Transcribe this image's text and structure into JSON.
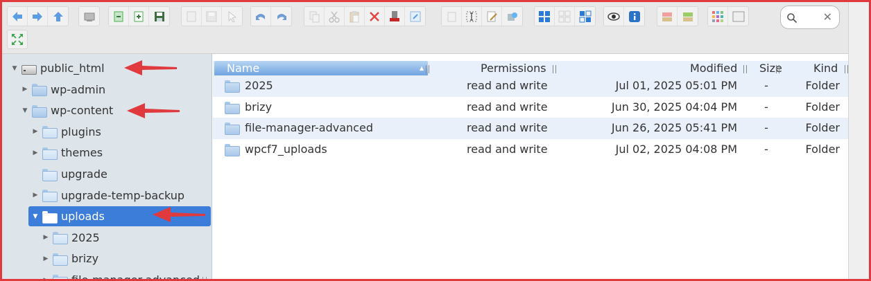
{
  "toolbar": {
    "groups": [
      [
        "back-icon",
        "forward-icon",
        "up-icon"
      ],
      [
        "home-icon"
      ],
      [
        "reload-icon",
        "new-file-icon",
        "save-icon"
      ],
      [
        "copy-doc-icon",
        "disk-icon",
        "select-icon"
      ],
      [
        "undo-icon",
        "redo-icon"
      ],
      [
        "copy-icon",
        "cut-icon",
        "paste-icon",
        "delete-icon",
        "empty-icon",
        "resize-icon"
      ],
      [
        "duplicate-icon",
        "rename-icon",
        "edit-icon",
        "extract-icon"
      ],
      [
        "grid-view-icon",
        "thumbs-icon",
        "list-view-icon"
      ],
      [
        "preview-icon",
        "info-icon"
      ],
      [
        "archive-icon",
        "unarchive-icon"
      ],
      [
        "icons-view-icon",
        "spell-icon"
      ]
    ],
    "search_placeholder": "",
    "clear_symbol": "✕"
  },
  "tree": {
    "rows": [
      {
        "label": "public_html",
        "icon": "drive-icon",
        "expander": "expanded",
        "level": 0
      },
      {
        "label": "wp-admin",
        "icon": "folder-icon",
        "expander": "collapsed",
        "level": 1
      },
      {
        "label": "wp-content",
        "icon": "folder-icon",
        "expander": "expanded",
        "level": 1
      },
      {
        "label": "plugins",
        "icon": "folder-icon",
        "expander": "collapsed",
        "level": 2
      },
      {
        "label": "themes",
        "icon": "folder-icon",
        "expander": "collapsed",
        "level": 2
      },
      {
        "label": "upgrade",
        "icon": "folder-icon",
        "expander": "none",
        "level": 2
      },
      {
        "label": "upgrade-temp-backup",
        "icon": "folder-icon",
        "expander": "collapsed",
        "level": 2
      },
      {
        "label": "uploads",
        "icon": "folder-icon",
        "expander": "expanded",
        "level": 2,
        "selected": true
      },
      {
        "label": "2025",
        "icon": "folder-icon",
        "expander": "collapsed",
        "level": 3
      },
      {
        "label": "brizy",
        "icon": "folder-icon",
        "expander": "collapsed",
        "level": 3
      },
      {
        "label": "file-manager-advanced",
        "icon": "folder-icon",
        "expander": "collapsed",
        "level": 3
      }
    ]
  },
  "list": {
    "columns": {
      "name": "Name",
      "permissions": "Permissions",
      "modified": "Modified",
      "size": "Size",
      "kind": "Kind"
    },
    "rows": [
      {
        "name": "2025",
        "permissions": "read and write",
        "modified": "Jul 01, 2025 05:01 PM",
        "size": "-",
        "kind": "Folder"
      },
      {
        "name": "brizy",
        "permissions": "read and write",
        "modified": "Jun 30, 2025 04:04 PM",
        "size": "-",
        "kind": "Folder"
      },
      {
        "name": "file-manager-advanced",
        "permissions": "read and write",
        "modified": "Jun 26, 2025 05:41 PM",
        "size": "-",
        "kind": "Folder"
      },
      {
        "name": "wpcf7_uploads",
        "permissions": "read and write",
        "modified": "Jul 02, 2025 04:08 PM",
        "size": "-",
        "kind": "Folder"
      }
    ]
  },
  "colors": {
    "selection": "#3b7dd8",
    "tree_background": "#dde4ea",
    "annotation_arrow": "#e0393e",
    "frame_border": "#e0393e"
  }
}
